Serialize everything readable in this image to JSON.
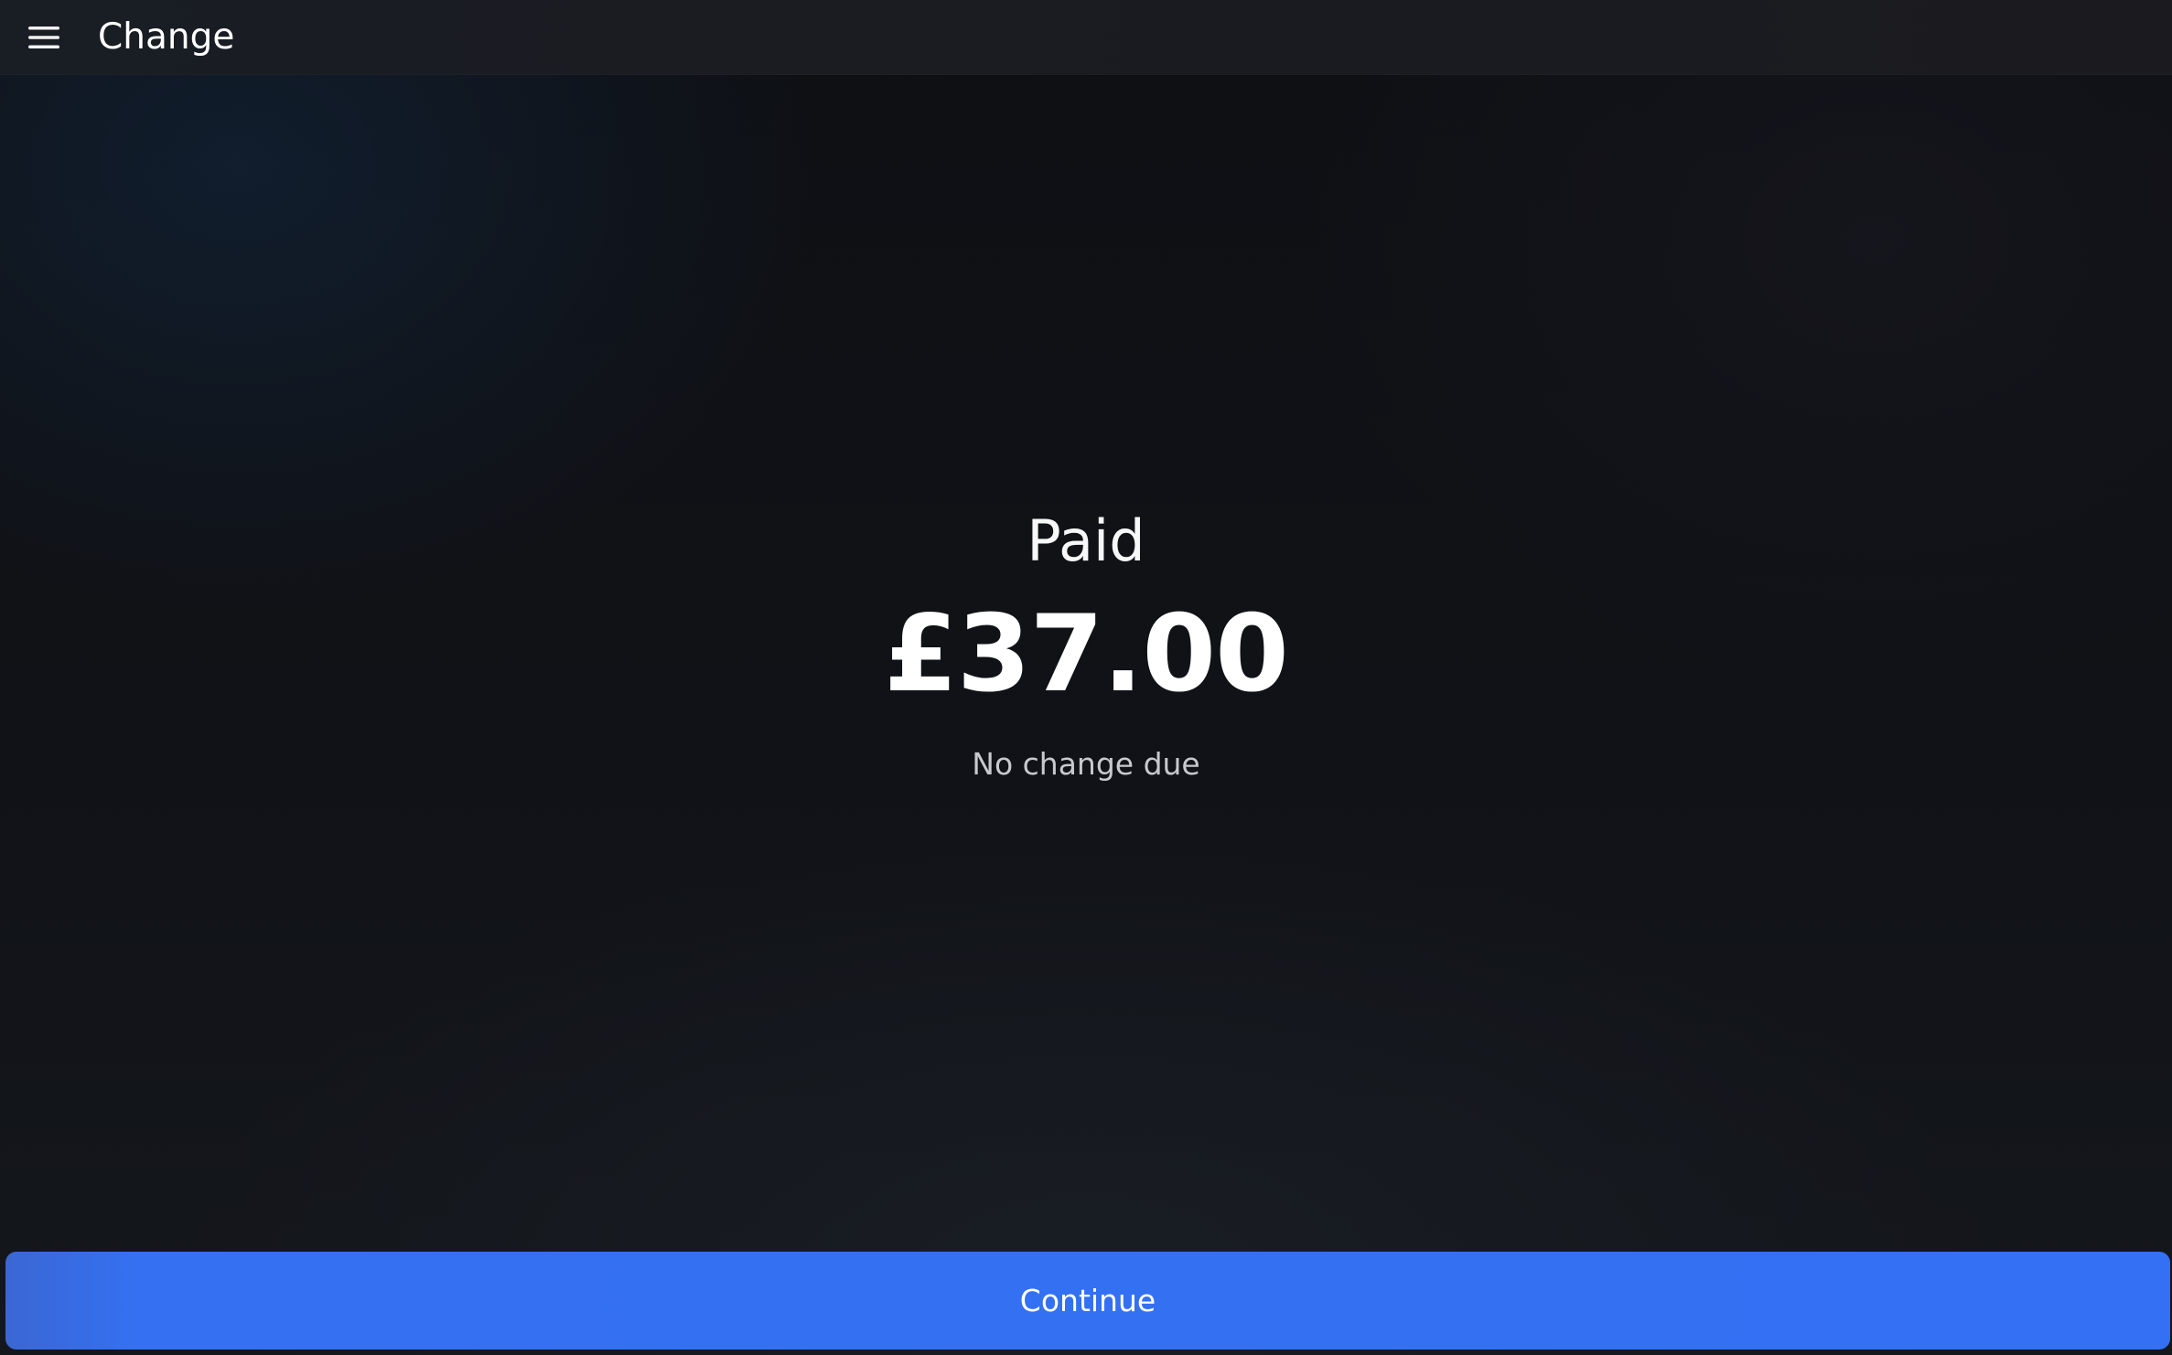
{
  "header": {
    "menu_icon": "hamburger-menu-icon",
    "title": "Change"
  },
  "payment": {
    "status_label": "Paid",
    "amount": "£37.00",
    "change_message": "No change due"
  },
  "actions": {
    "continue_label": "Continue"
  },
  "colors": {
    "background": "#0f1116",
    "header_background": "#1a1b20",
    "primary_button": "#3470f3",
    "text_primary": "#ffffff",
    "text_secondary": "#c7c9ce"
  }
}
